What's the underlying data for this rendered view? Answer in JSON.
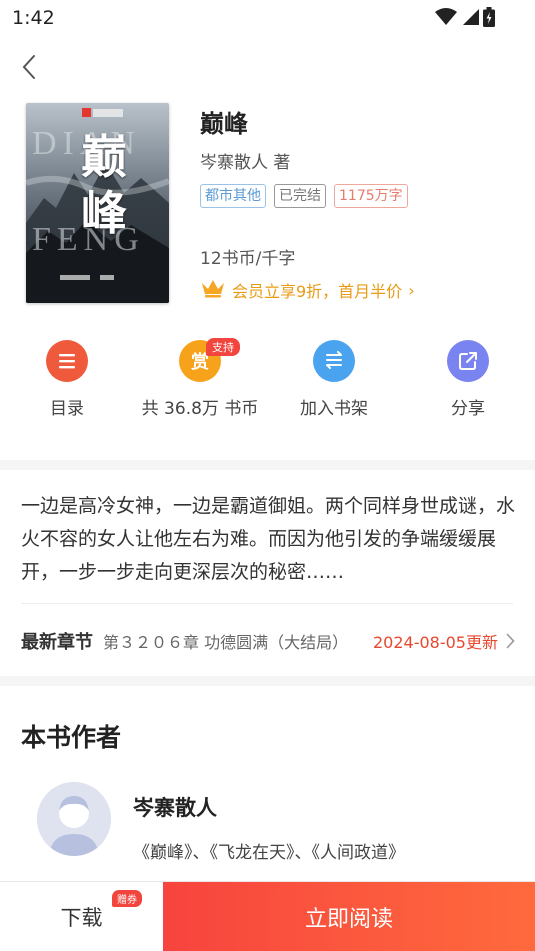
{
  "status": {
    "time": "1:42",
    "icons": [
      "wifi-icon",
      "signal-icon",
      "battery-icon"
    ]
  },
  "nav": {
    "back_icon": "back-arrow-icon"
  },
  "book": {
    "cover": {
      "title": "巅峰",
      "english": "DIAN FENG",
      "publisher_logo": "publisher-logo"
    },
    "title": "巅峰",
    "author_line": "岑寨散人 著",
    "tags": [
      "都市其他",
      "已完结",
      "1175万字"
    ],
    "price": "12书币/千字",
    "vip_offer": "会员立享9折，首月半价",
    "vip_chevron": "›"
  },
  "actions": [
    {
      "label": "目录",
      "icon": "catalog-icon",
      "color": "#f05a3c"
    },
    {
      "label": "共 36.8万 书币",
      "icon": "reward-icon",
      "color": "#f7a21b",
      "badge": "支持",
      "glyph": "赏"
    },
    {
      "label": "加入书架",
      "icon": "bookshelf-icon",
      "color": "#4aa3ef"
    },
    {
      "label": "分享",
      "icon": "share-icon",
      "color": "#7a84f0"
    }
  ],
  "synopsis": "一边是高冷女神，一边是霸道御姐。两个同样身世成谜，水火不容的女人让他左右为难。而因为他引发的争端缓缓展开，一步一步走向更深层次的秘密……",
  "latest": {
    "label": "最新章节",
    "chapter": "第３２０６章 功德圆满（大结局）",
    "date": "2024-08-05更新",
    "chevron": "›"
  },
  "author_section": {
    "title": "本书作者",
    "name": "岑寨散人",
    "works": "《巅峰》、《飞龙在天》、《人间政道》"
  },
  "bottom": {
    "download": "下载",
    "coupon_badge": "赠券",
    "read": "立即阅读"
  },
  "colors": {
    "accent": "#f7443e",
    "vip": "#e99b14",
    "date": "#e8472e"
  }
}
